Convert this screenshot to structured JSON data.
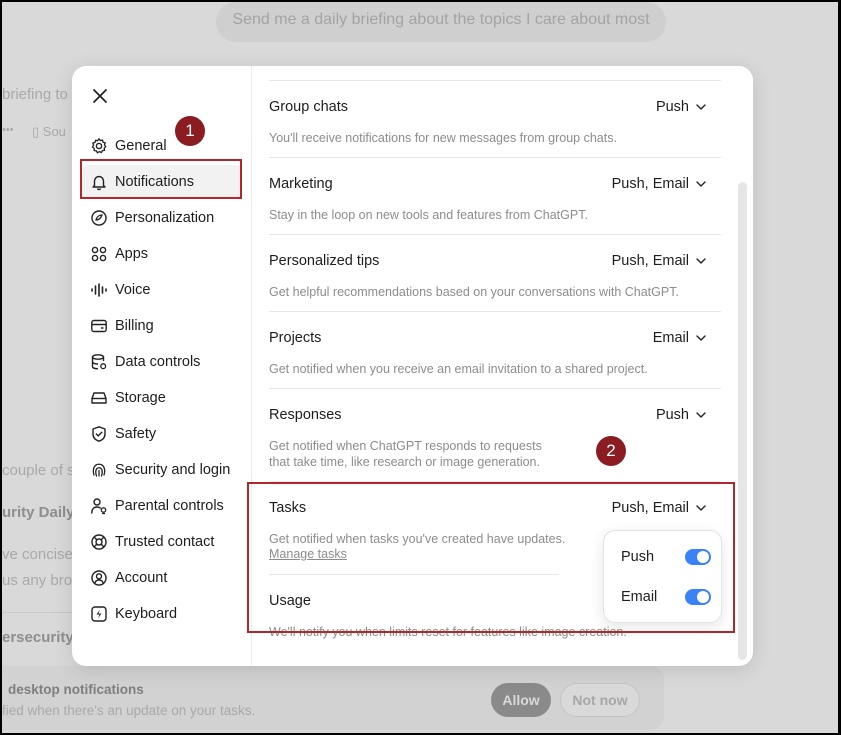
{
  "background": {
    "suggestion": "Send me a daily briefing about the topics I care about most",
    "fragments": {
      "briefing": "briefing to",
      "more": "•••",
      "sources": "Sou",
      "couple": "couple of s",
      "daily": "urity Daily",
      "concise": "ve concise",
      "broad": "us any bro",
      "cyber": "ersecurity I"
    },
    "notification_banner": {
      "title": "desktop notifications",
      "subtitle": "fied when there's an update on your tasks.",
      "allow_label": "Allow",
      "not_now_label": "Not now"
    }
  },
  "sidebar": {
    "items": [
      {
        "label": "General",
        "icon": "gear-icon"
      },
      {
        "label": "Notifications",
        "icon": "bell-icon"
      },
      {
        "label": "Personalization",
        "icon": "personalization-icon"
      },
      {
        "label": "Apps",
        "icon": "apps-grid-icon"
      },
      {
        "label": "Voice",
        "icon": "waveform-icon"
      },
      {
        "label": "Billing",
        "icon": "card-icon"
      },
      {
        "label": "Data controls",
        "icon": "database-icon"
      },
      {
        "label": "Storage",
        "icon": "drive-icon"
      },
      {
        "label": "Safety",
        "icon": "shield-icon"
      },
      {
        "label": "Security and login",
        "icon": "fingerprint-icon"
      },
      {
        "label": "Parental controls",
        "icon": "parental-icon"
      },
      {
        "label": "Trusted contact",
        "icon": "lifebuoy-icon"
      },
      {
        "label": "Account",
        "icon": "account-icon"
      },
      {
        "label": "Keyboard",
        "icon": "keyboard-icon"
      }
    ],
    "active": "Notifications"
  },
  "settings": [
    {
      "title": "Group chats",
      "value": "Push",
      "desc": "You'll receive notifications for new messages from group chats."
    },
    {
      "title": "Marketing",
      "value": "Push, Email",
      "desc": "Stay in the loop on new tools and features from ChatGPT."
    },
    {
      "title": "Personalized tips",
      "value": "Push, Email",
      "desc": "Get helpful recommendations based on your conversations with ChatGPT."
    },
    {
      "title": "Projects",
      "value": "Email",
      "desc": "Get notified when you receive an email invitation to a shared project."
    },
    {
      "title": "Responses",
      "value": "Push",
      "desc_line1": "Get notified when ChatGPT responds to requests",
      "desc_line2": "that take time, like research or image generation."
    },
    {
      "title": "Tasks",
      "value": "Push, Email",
      "desc": "Get notified when tasks you've created have updates.",
      "link": "Manage tasks"
    },
    {
      "title": "Usage",
      "desc": "We'll notify you when limits reset for features like image creation."
    }
  ],
  "dropdown": {
    "options": [
      {
        "label": "Push",
        "enabled": true
      },
      {
        "label": "Email",
        "enabled": true
      }
    ]
  },
  "annotations": {
    "badge1": "1",
    "badge2": "2"
  },
  "colors": {
    "toggle_on": "#3b82f6",
    "annotation_red": "#b3262b",
    "badge_fill": "#8b1c22"
  }
}
